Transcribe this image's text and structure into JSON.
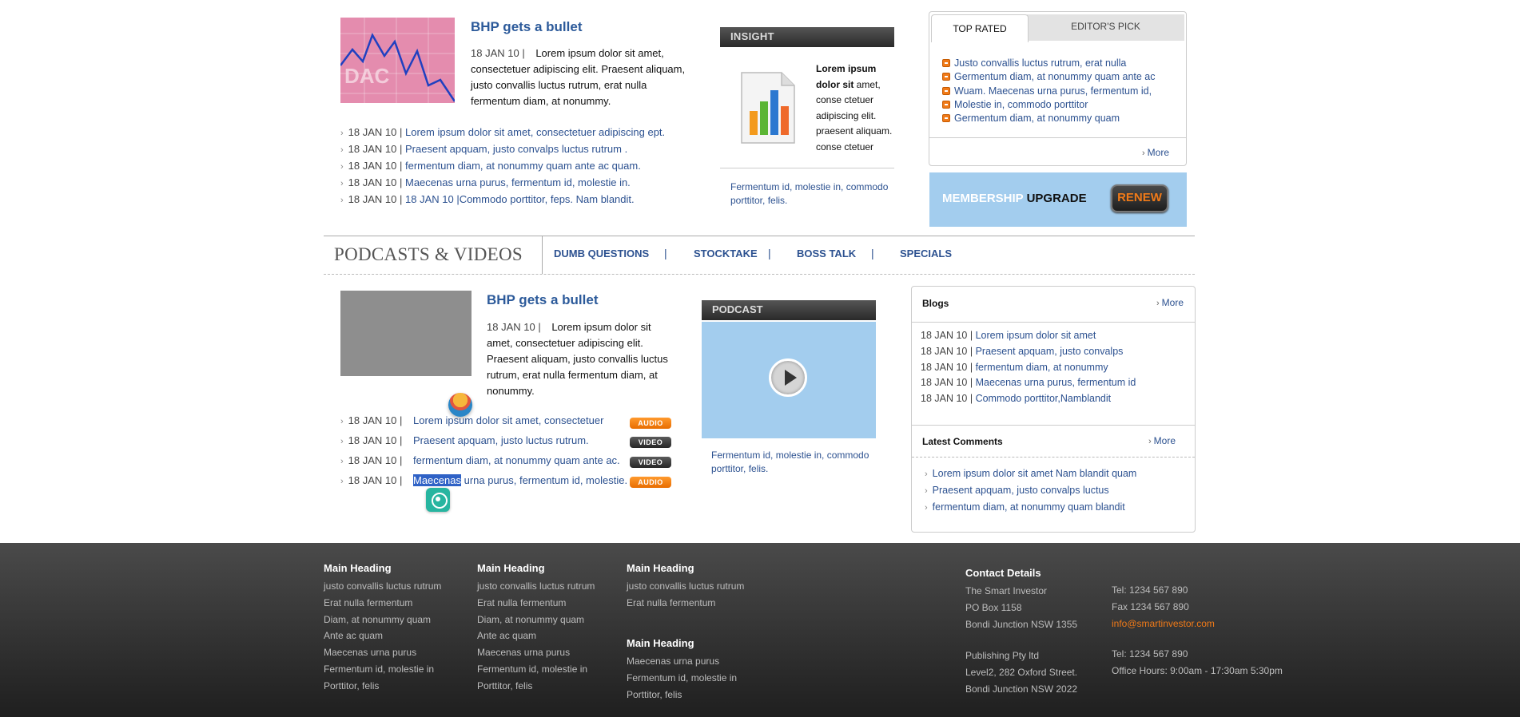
{
  "top_news": {
    "title": "BHP gets a bullet",
    "date": "18 JAN 10 |",
    "body": "Lorem ipsum dolor sit amet, consectetuer adipiscing elit. Praesent aliquam, justo convallis luctus rutrum, erat nulla fermentum diam, at nonummy.",
    "thumb_alt": "stock chart image",
    "items": [
      {
        "date": "18 JAN 10 |",
        "text": "Lorem ipsum dolor sit amet, consectetuer adipiscing ept."
      },
      {
        "date": "18 JAN 10 |",
        "text": "Praesent apquam, justo convalps luctus rutrum ."
      },
      {
        "date": "18 JAN 10 |",
        "text": "fermentum diam, at nonummy quam ante ac quam."
      },
      {
        "date": "18 JAN 10 |",
        "text": "Maecenas urna purus, fermentum id, molestie in."
      },
      {
        "date": "18 JAN 10 |",
        "text": "18 JAN 10 |Commodo porttitor, feps. Nam blandit."
      }
    ]
  },
  "insight": {
    "header": "INSIGHT",
    "text_bold": "Lorem ipsum dolor sit",
    "text_rest": " amet, conse ctetuer adipiscing elit. praesent aliquam. conse ctetuer",
    "footer": "Fermentum id, molestie in, commodo porttitor, felis."
  },
  "rated": {
    "tab_active": "TOP RATED",
    "tab_inactive": "EDITOR'S PICK",
    "items": [
      "Justo convallis luctus rutrum, erat nulla",
      "Germentum diam, at nonummy quam ante ac",
      "Wuam. Maecenas urna purus, fermentum id,",
      "Molestie in, commodo porttitor",
      "Germentum diam, at nonummy quam"
    ],
    "more": "More"
  },
  "membership": {
    "label_light": "MEMBERSHIP",
    "label_dark": "UPGRADE",
    "button": "RENEW"
  },
  "podcasts_bar": {
    "title": "PODCASTS & VIDEOS",
    "nav": [
      "DUMB QUESTIONS",
      "STOCKTAKE",
      "BOSS TALK",
      "SPECIALS"
    ],
    "pipe": "|"
  },
  "podcast_news": {
    "title": "BHP gets a bullet",
    "date": "18 JAN 10 |",
    "body": "Lorem ipsum dolor sit amet, consectetuer adipiscing elit. Praesent aliquam, justo convallis luctus rutrum, erat nulla fermentum diam, at nonummy.",
    "items": [
      {
        "date": "18 JAN 10 |",
        "text": "Lorem ipsum dolor sit amet, consectetuer",
        "badge": "AUDIO"
      },
      {
        "date": "18 JAN 10 |",
        "text": "Praesent apquam, justo luctus rutrum.",
        "badge": "VIDEO"
      },
      {
        "date": "18 JAN 10 |",
        "text": "fermentum diam, at nonummy quam ante ac.",
        "badge": "VIDEO"
      },
      {
        "date": "18 JAN 10 |",
        "text_selected": "Maecenas",
        "text": " urna purus, fermentum id, molestie.",
        "badge": "AUDIO"
      }
    ]
  },
  "podcast_player": {
    "header": "PODCAST",
    "footer": "Fermentum id, molestie in, commodo porttitor, felis."
  },
  "blogs": {
    "title": "Blogs",
    "more": "More",
    "items": [
      {
        "date": "18 JAN 10 |",
        "text": "Lorem ipsum dolor sit amet"
      },
      {
        "date": "18 JAN 10 |",
        "text": "Praesent apquam, justo convalps"
      },
      {
        "date": "18 JAN 10 |",
        "text": "fermentum diam, at nonummy"
      },
      {
        "date": "18 JAN 10 |",
        "text": "Maecenas urna purus, fermentum id"
      },
      {
        "date": "18 JAN 10 |",
        "text": "Commodo porttitor,Namblandit"
      }
    ]
  },
  "comments": {
    "title": "Latest Comments",
    "more": "More",
    "items": [
      "Lorem ipsum dolor sit amet Nam blandit quam",
      "Praesent apquam, justo convalps luctus",
      "fermentum diam, at nonummy quam blandit"
    ]
  },
  "footer": {
    "col1": {
      "heading": "Main Heading",
      "items": [
        "justo convallis luctus rutrum",
        "Erat nulla fermentum",
        "Diam, at nonummy quam",
        "Ante ac quam",
        "Maecenas urna purus",
        "Fermentum id, molestie in",
        "Porttitor, felis"
      ]
    },
    "col2": {
      "heading": "Main Heading",
      "items": [
        "justo convallis luctus rutrum",
        "Erat nulla fermentum",
        "Diam, at nonummy quam",
        "Ante ac quam",
        "Maecenas urna purus",
        "Fermentum id, molestie in",
        "Porttitor, felis"
      ]
    },
    "col3a": {
      "heading": "Main Heading",
      "items": [
        "justo convallis luctus rutrum",
        "Erat nulla fermentum"
      ]
    },
    "col3b": {
      "heading": "Main Heading",
      "items": [
        "Maecenas urna purus",
        "Fermentum id, molestie in",
        "Porttitor, felis"
      ]
    },
    "contact": {
      "heading": "Contact Details",
      "address": [
        "The Smart Investor",
        "PO Box 1158",
        "Bondi Junction NSW 1355"
      ],
      "address2": [
        "Publishing Pty ltd",
        "Level2, 282 Oxford Street.",
        "Bondi Junction NSW 2022"
      ],
      "tel": "Tel: 1234 567 890",
      "fax": "Fax 1234 567 890",
      "email": "info@smartinvestor.com",
      "tel2": "Tel: 1234 567 890",
      "hours": "Office Hours: 9:00am - 17:30am 5:30pm"
    }
  },
  "colors": {
    "accent_blue": "#2c5190",
    "orange": "#f07a18",
    "sky": "#a3cdee"
  }
}
